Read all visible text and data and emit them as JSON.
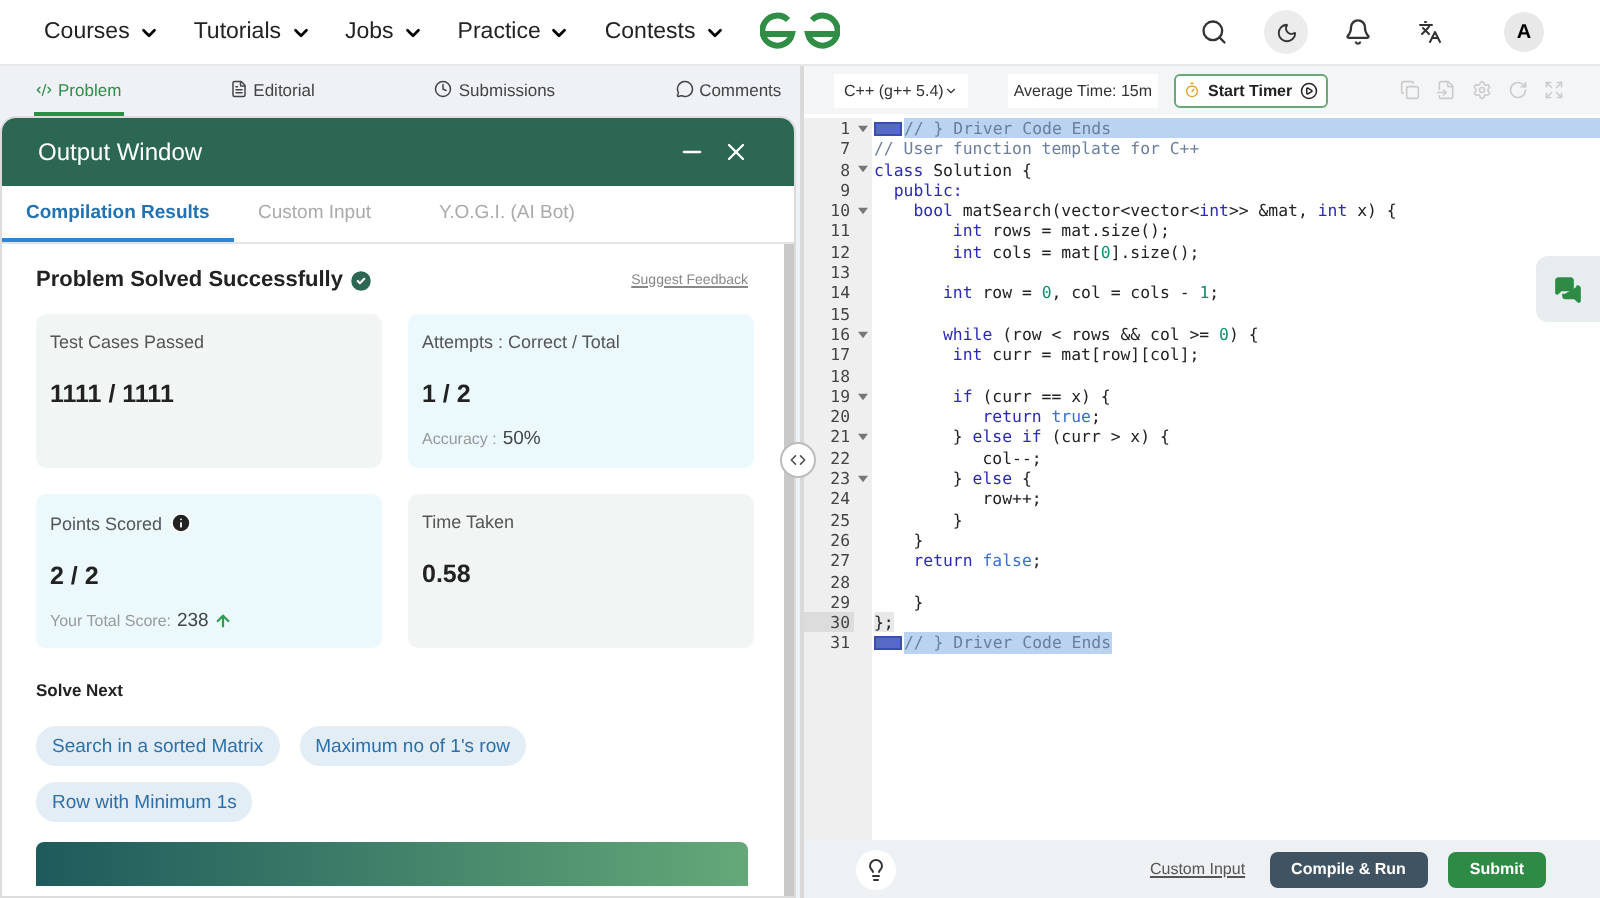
{
  "nav": {
    "menus": [
      "Courses",
      "Tutorials",
      "Jobs",
      "Practice",
      "Contests"
    ],
    "avatar": "A"
  },
  "problem_tabs": [
    {
      "label": "Problem",
      "kind": "code",
      "selected": true
    },
    {
      "label": "Editorial",
      "kind": "doc",
      "selected": false
    },
    {
      "label": "Submissions",
      "kind": "clock",
      "selected": false
    },
    {
      "label": "Comments",
      "kind": "chat",
      "selected": false
    }
  ],
  "output_window": {
    "title": "Output Window",
    "tabs": [
      {
        "label": "Compilation Results",
        "selected": true
      },
      {
        "label": "Custom Input",
        "selected": false
      },
      {
        "label": "Y.O.G.I. (AI Bot)",
        "selected": false
      }
    ],
    "result": "Problem Solved Successfully",
    "feedback_link": "Suggest Feedback",
    "cards": [
      {
        "label": "Test Cases Passed",
        "value": "1111 / 1111",
        "color": "#f1f5f4"
      },
      {
        "label": "Attempts : Correct / Total",
        "value": "1 / 2",
        "color": "#ebf9fc",
        "note": {
          "label": "Accuracy :",
          "value": "50%"
        }
      },
      {
        "label": "Points Scored",
        "value": "2 / 2",
        "color": "#ebf9fc",
        "info": true,
        "note": {
          "label": "Your Total Score:",
          "value": "238",
          "rising": true
        }
      },
      {
        "label": "Time Taken",
        "value": "0.58",
        "color": "#f1f5f4"
      }
    ],
    "solve_next": {
      "title": "Solve Next",
      "items": [
        "Search in a sorted Matrix",
        "Maximum no of 1's row",
        "Row with Minimum 1s"
      ]
    }
  },
  "editor": {
    "language": "C++ (g++ 5.4)",
    "average_time": "Average Time: 15m",
    "timer_button": "Start Timer",
    "lines": [
      {
        "n": "1",
        "fold": true,
        "selected": true,
        "marker": true,
        "seg": [
          {
            "kind": "comment",
            "t": "// } Driver Code Ends"
          }
        ]
      },
      {
        "n": "7",
        "seg": [
          {
            "kind": "comment",
            "t": "// User function template for C++"
          }
        ]
      },
      {
        "n": "8",
        "fold": true,
        "seg": [
          {
            "kind": "keyword",
            "t": "class"
          },
          {
            "kind": "plain",
            "t": " Solution {"
          }
        ]
      },
      {
        "n": "9",
        "seg": [
          {
            "kind": "keyword",
            "t": "  public:"
          }
        ]
      },
      {
        "n": "10",
        "fold": true,
        "seg": [
          {
            "kind": "keyword",
            "t": "    bool"
          },
          {
            "kind": "plain",
            "t": " matSearch(vector<vector<"
          },
          {
            "kind": "keyword",
            "t": "int"
          },
          {
            "kind": "plain",
            "t": ">> &mat, "
          },
          {
            "kind": "keyword",
            "t": "int"
          },
          {
            "kind": "plain",
            "t": " x) {"
          }
        ]
      },
      {
        "n": "11",
        "seg": [
          {
            "kind": "keyword",
            "t": "        int"
          },
          {
            "kind": "plain",
            "t": " rows = mat.size();"
          }
        ]
      },
      {
        "n": "12",
        "seg": [
          {
            "kind": "keyword",
            "t": "        int"
          },
          {
            "kind": "plain",
            "t": " cols = mat["
          },
          {
            "kind": "number",
            "t": "0"
          },
          {
            "kind": "plain",
            "t": "].size();"
          }
        ]
      },
      {
        "n": "13"
      },
      {
        "n": "14",
        "seg": [
          {
            "kind": "keyword",
            "t": "       int"
          },
          {
            "kind": "plain",
            "t": " row = "
          },
          {
            "kind": "number",
            "t": "0"
          },
          {
            "kind": "plain",
            "t": ", col = cols - "
          },
          {
            "kind": "number",
            "t": "1"
          },
          {
            "kind": "plain",
            "t": ";"
          }
        ]
      },
      {
        "n": "15"
      },
      {
        "n": "16",
        "fold": true,
        "seg": [
          {
            "kind": "keyword",
            "t": "       while"
          },
          {
            "kind": "plain",
            "t": " (row < rows && col >= "
          },
          {
            "kind": "number",
            "t": "0"
          },
          {
            "kind": "plain",
            "t": ") {"
          }
        ]
      },
      {
        "n": "17",
        "seg": [
          {
            "kind": "keyword",
            "t": "        int"
          },
          {
            "kind": "plain",
            "t": " curr = mat[row][col];"
          }
        ]
      },
      {
        "n": "18"
      },
      {
        "n": "19",
        "fold": true,
        "seg": [
          {
            "kind": "keyword",
            "t": "        if"
          },
          {
            "kind": "plain",
            "t": " (curr == x) {"
          }
        ]
      },
      {
        "n": "20",
        "seg": [
          {
            "kind": "keyword",
            "t": "           return"
          },
          {
            "kind": "boolean",
            "t": " true"
          },
          {
            "kind": "plain",
            "t": ";"
          }
        ]
      },
      {
        "n": "21",
        "fold": true,
        "seg": [
          {
            "kind": "plain",
            "t": "        } "
          },
          {
            "kind": "keyword",
            "t": "else if"
          },
          {
            "kind": "plain",
            "t": " (curr > x) {"
          }
        ]
      },
      {
        "n": "22",
        "seg": [
          {
            "kind": "plain",
            "t": "           col--;"
          }
        ]
      },
      {
        "n": "23",
        "fold": true,
        "seg": [
          {
            "kind": "plain",
            "t": "        } "
          },
          {
            "kind": "keyword",
            "t": "else"
          },
          {
            "kind": "plain",
            "t": " {"
          }
        ]
      },
      {
        "n": "24",
        "seg": [
          {
            "kind": "plain",
            "t": "           row++;"
          }
        ]
      },
      {
        "n": "25",
        "seg": [
          {
            "kind": "plain",
            "t": "        }"
          }
        ]
      },
      {
        "n": "26",
        "seg": [
          {
            "kind": "plain",
            "t": "    }"
          }
        ]
      },
      {
        "n": "27",
        "seg": [
          {
            "kind": "keyword",
            "t": "    return"
          },
          {
            "kind": "boolean",
            "t": " false"
          },
          {
            "kind": "plain",
            "t": ";"
          }
        ]
      },
      {
        "n": "28"
      },
      {
        "n": "29",
        "seg": [
          {
            "kind": "plain",
            "t": "    }"
          }
        ]
      },
      {
        "n": "30",
        "active": true,
        "seg": [
          {
            "kind": "plain",
            "t": "};"
          }
        ]
      },
      {
        "n": "31",
        "text_selected": true,
        "marker": true,
        "seg": [
          {
            "kind": "comment",
            "t": "// } Driver Code Ends"
          }
        ]
      }
    ],
    "custom_input_link": "Custom Input",
    "compile_button": "Compile & Run",
    "submit_button": "Submit"
  }
}
